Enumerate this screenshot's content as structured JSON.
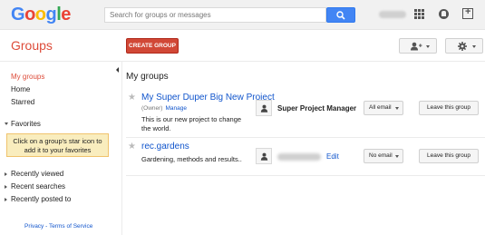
{
  "header": {
    "logo_letters": [
      {
        "ch": "G",
        "color": "#4285f4"
      },
      {
        "ch": "o",
        "color": "#ea4335"
      },
      {
        "ch": "o",
        "color": "#fbbc05"
      },
      {
        "ch": "g",
        "color": "#4285f4"
      },
      {
        "ch": "l",
        "color": "#34a853"
      },
      {
        "ch": "e",
        "color": "#ea4335"
      }
    ],
    "search_placeholder": "Search for groups or messages",
    "search_icon": "search-icon",
    "apps_icon": "apps-grid-icon",
    "notifications_icon": "notifications-icon",
    "share_icon": "share-plus-icon"
  },
  "toolbar": {
    "section_title": "Groups",
    "create_label": "CREATE GROUP",
    "people_icon": "add-person-icon",
    "settings_icon": "gear-icon"
  },
  "sidebar": {
    "items": [
      {
        "label": "My groups",
        "active": true
      },
      {
        "label": "Home",
        "active": false
      },
      {
        "label": "Starred",
        "active": false
      }
    ],
    "favorites_label": "Favorites",
    "favorites_hint_line1": "Click on a group's star icon to",
    "favorites_hint_line2": "add it to your favorites",
    "recent": [
      {
        "label": "Recently viewed"
      },
      {
        "label": "Recent searches"
      },
      {
        "label": "Recently posted to"
      }
    ],
    "footer": "Privacy - Terms of Service"
  },
  "main": {
    "title": "My groups",
    "groups": [
      {
        "name": "My Super Duper Big New Project",
        "role": "(Owner)",
        "manage_label": "Manage",
        "description_line1": "This is our new project to change",
        "description_line2": "the world.",
        "member_label": "Super Project Manager",
        "email_setting": "All email",
        "leave_label": "Leave this group"
      },
      {
        "name": "rec.gardens",
        "description_line1": "Gardening, methods and results..",
        "edit_label": "Edit",
        "email_setting": "No email",
        "leave_label": "Leave this group"
      }
    ]
  },
  "colors": {
    "accent_red": "#dd4b39",
    "create_button": "#d14836",
    "link_blue": "#1155cc",
    "search_blue": "#4285f4",
    "favorites_bg": "#f9edbe"
  }
}
